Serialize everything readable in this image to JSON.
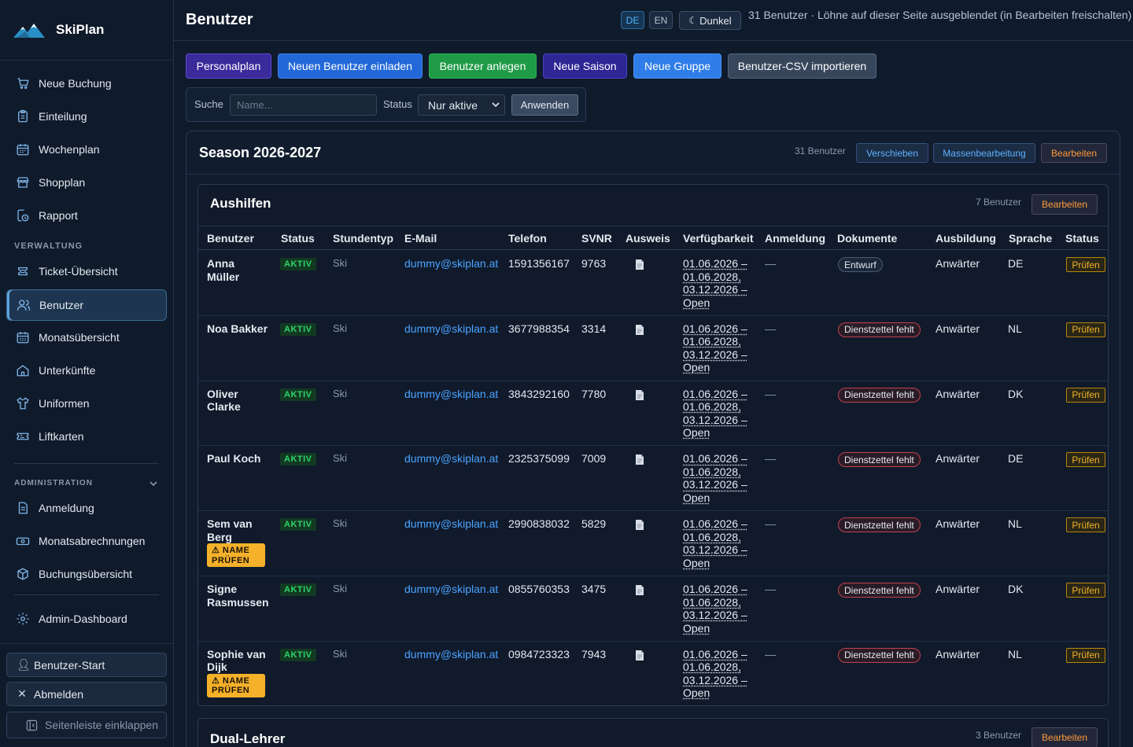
{
  "brand": {
    "name": "SkiPlan"
  },
  "sidebar": {
    "main_items": [
      {
        "label": "Neue Buchung",
        "icon": "cart-icon"
      },
      {
        "label": "Einteilung",
        "icon": "clipboard-icon"
      },
      {
        "label": "Wochenplan",
        "icon": "calendar-icon"
      },
      {
        "label": "Shopplan",
        "icon": "store-icon"
      },
      {
        "label": "Rapport",
        "icon": "report-clock-icon"
      }
    ],
    "section_verwaltung": "VERWALTUNG",
    "verwaltung_items": [
      {
        "label": "Ticket-Übersicht",
        "icon": "ticket-icon"
      },
      {
        "label": "Benutzer",
        "icon": "users-icon",
        "active": true
      },
      {
        "label": "Monatsübersicht",
        "icon": "calendar-grid-icon"
      },
      {
        "label": "Unterkünfte",
        "icon": "home-icon"
      },
      {
        "label": "Uniformen",
        "icon": "shirt-icon"
      },
      {
        "label": "Liftkarten",
        "icon": "lift-ticket-icon"
      }
    ],
    "section_admin": "ADMINISTRATION",
    "admin_items": [
      {
        "label": "Anmeldung",
        "icon": "document-icon"
      },
      {
        "label": "Monatsabrechnungen",
        "icon": "money-icon"
      },
      {
        "label": "Buchungsübersicht",
        "icon": "box-icon"
      }
    ],
    "dashboard": {
      "label": "Admin-Dashboard",
      "icon": "gear-icon"
    },
    "user_start": "Benutzer-Start",
    "logout": "Abmelden",
    "collapse": "Seitenleiste einklappen"
  },
  "header": {
    "title": "Benutzer",
    "lang_de": "DE",
    "lang_en": "EN",
    "theme": "Dunkel",
    "info": "31 Benutzer · Löhne auf dieser Seite ausgeblendet (in Bearbeiten freischalten)"
  },
  "actions": {
    "personalplan": "Personalplan",
    "invite": "Neuen Benutzer einladen",
    "create": "Benutzer anlegen",
    "season": "Neue Saison",
    "group": "Neue Gruppe",
    "csv": "Benutzer-CSV importieren"
  },
  "filter": {
    "search_label": "Suche",
    "search_placeholder": "Name...",
    "status_label": "Status",
    "status_value": "Nur aktive",
    "apply": "Anwenden"
  },
  "season": {
    "title": "Season 2026-2027",
    "count": "31 Benutzer",
    "move": "Verschieben",
    "bulk": "Massenbearbeitung",
    "edit": "Bearbeiten"
  },
  "group_aushilfen": {
    "title": "Aushilfen",
    "count": "7 Benutzer",
    "edit": "Bearbeiten",
    "columns": [
      "Benutzer",
      "Status",
      "Stundentyp",
      "E-Mail",
      "Telefon",
      "SVNR",
      "Ausweis",
      "Verfügbarkeit",
      "Anmeldung",
      "Dokumente",
      "Ausbildung",
      "Sprache",
      "Status"
    ],
    "rows": [
      {
        "name": "Anna Müller",
        "status": "AKTIV",
        "type": "Ski",
        "email": "dummy@skiplan.at",
        "phone": "1591356167",
        "svnr": "9763",
        "avail": "01.06.2026 – 01.06.2028, 03.12.2026 – Open",
        "reg": "—",
        "doc": "Entwurf",
        "doc_kind": "draft",
        "training": "Anwärter",
        "lang": "DE",
        "check": "Prüfen",
        "warn": ""
      },
      {
        "name": "Noa Bakker",
        "status": "AKTIV",
        "type": "Ski",
        "email": "dummy@skiplan.at",
        "phone": "3677988354",
        "svnr": "3314",
        "avail": "01.06.2026 – 01.06.2028, 03.12.2026 – Open",
        "reg": "—",
        "doc": "Dienstzettel fehlt",
        "doc_kind": "missing",
        "training": "Anwärter",
        "lang": "NL",
        "check": "Prüfen",
        "warn": ""
      },
      {
        "name": "Oliver Clarke",
        "status": "AKTIV",
        "type": "Ski",
        "email": "dummy@skiplan.at",
        "phone": "3843292160",
        "svnr": "7780",
        "avail": "01.06.2026 – 01.06.2028, 03.12.2026 – Open",
        "reg": "—",
        "doc": "Dienstzettel fehlt",
        "doc_kind": "missing",
        "training": "Anwärter",
        "lang": "DK",
        "check": "Prüfen",
        "warn": ""
      },
      {
        "name": "Paul Koch",
        "status": "AKTIV",
        "type": "Ski",
        "email": "dummy@skiplan.at",
        "phone": "2325375099",
        "svnr": "7009",
        "avail": "01.06.2026 – 01.06.2028, 03.12.2026 – Open",
        "reg": "—",
        "doc": "Dienstzettel fehlt",
        "doc_kind": "missing",
        "training": "Anwärter",
        "lang": "DE",
        "check": "Prüfen",
        "warn": ""
      },
      {
        "name": "Sem van Berg",
        "status": "AKTIV",
        "type": "Ski",
        "email": "dummy@skiplan.at",
        "phone": "2990838032",
        "svnr": "5829",
        "avail": "01.06.2026 – 01.06.2028, 03.12.2026 – Open",
        "reg": "—",
        "doc": "Dienstzettel fehlt",
        "doc_kind": "missing",
        "training": "Anwärter",
        "lang": "NL",
        "check": "Prüfen",
        "warn": "⚠ NAME PRÜFEN"
      },
      {
        "name": "Signe Rasmussen",
        "status": "AKTIV",
        "type": "Ski",
        "email": "dummy@skiplan.at",
        "phone": "0855760353",
        "svnr": "3475",
        "avail": "01.06.2026 – 01.06.2028, 03.12.2026 – Open",
        "reg": "—",
        "doc": "Dienstzettel fehlt",
        "doc_kind": "missing",
        "training": "Anwärter",
        "lang": "DK",
        "check": "Prüfen",
        "warn": ""
      },
      {
        "name": "Sophie van Dijk",
        "status": "AKTIV",
        "type": "Ski",
        "email": "dummy@skiplan.at",
        "phone": "0984723323",
        "svnr": "7943",
        "avail": "01.06.2026 – 01.06.2028, 03.12.2026 – Open",
        "reg": "—",
        "doc": "Dienstzettel fehlt",
        "doc_kind": "missing",
        "training": "Anwärter",
        "lang": "NL",
        "check": "Prüfen",
        "warn": "⚠ NAME PRÜFEN"
      }
    ]
  },
  "group_dual": {
    "title": "Dual-Lehrer",
    "count": "3 Benutzer",
    "edit": "Bearbeiten"
  },
  "colors": {
    "background": "#0f1a2b",
    "accent_blue": "#4aa3ff",
    "active_green": "#2fd36b",
    "warning": "#f5b12a",
    "edit_orange": "#ff9a3a"
  }
}
